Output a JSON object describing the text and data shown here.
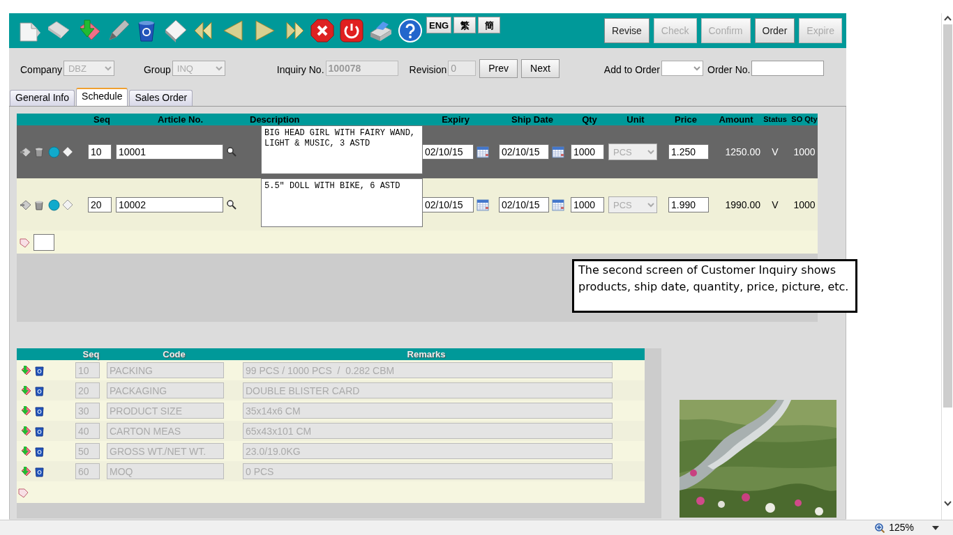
{
  "toolbar": {
    "language_buttons": [
      {
        "label": "ENG"
      },
      {
        "label": "繁"
      },
      {
        "label": "簡"
      }
    ],
    "action_buttons": [
      {
        "label": "Revise",
        "disabled": false
      },
      {
        "label": "Check",
        "disabled": true
      },
      {
        "label": "Confirm",
        "disabled": true
      },
      {
        "label": "Order",
        "disabled": false
      },
      {
        "label": "Expire",
        "disabled": true
      }
    ]
  },
  "header_form": {
    "company": {
      "label": "Company",
      "value": "DBZ",
      "disabled": true
    },
    "group": {
      "label": "Group",
      "value": "INQ",
      "disabled": true
    },
    "inquiry_no": {
      "label": "Inquiry No.",
      "value": "100078",
      "disabled": true
    },
    "revision": {
      "label": "Revision",
      "value": "0",
      "disabled": true
    },
    "nav_buttons": [
      "Prev",
      "Next"
    ],
    "add_to_order": {
      "label": "Add to Order"
    },
    "order_no": {
      "label": "Order No."
    }
  },
  "tabs": [
    {
      "label": "General Info",
      "selected": false
    },
    {
      "label": "Schedule",
      "selected": true
    },
    {
      "label": "Sales Order",
      "selected": false
    }
  ],
  "items": {
    "columns": [
      "Seq",
      "Article No.",
      "Description",
      "Expiry",
      "Ship Date",
      "Qty",
      "Unit",
      "Price",
      "Amount",
      "Status",
      "SO Qty"
    ],
    "rows": [
      {
        "seq": "10",
        "article_no": "10001",
        "description": "BIG HEAD GIRL WITH FAIRY WAND, LIGHT & MUSIC, 3 ASTD",
        "expiry": "02/10/15",
        "ship_date": "02/10/15",
        "qty": "1000",
        "unit": "PCS",
        "price": "1.250",
        "amount": "1250.00",
        "status": "V",
        "so_qty": "1000",
        "selected": true
      },
      {
        "seq": "20",
        "article_no": "10002",
        "description": "5.5\" DOLL WITH BIKE, 6 ASTD",
        "expiry": "02/10/15",
        "ship_date": "02/10/15",
        "qty": "1000",
        "unit": "PCS",
        "price": "1.990",
        "amount": "1990.00",
        "status": "V",
        "so_qty": "1000",
        "selected": false
      }
    ]
  },
  "remarks": {
    "columns": [
      "Seq",
      "Code",
      "Remarks"
    ],
    "rows": [
      {
        "seq": "10",
        "code": "PACKING",
        "remarks": "99 PCS / 1000 PCS  /  0.282 CBM"
      },
      {
        "seq": "20",
        "code": "PACKAGING",
        "remarks": "DOUBLE BLISTER CARD"
      },
      {
        "seq": "30",
        "code": "PRODUCT SIZE",
        "remarks": "35x14x6 CM"
      },
      {
        "seq": "40",
        "code": "CARTON MEAS",
        "remarks": "65x43x101 CM"
      },
      {
        "seq": "50",
        "code": "GROSS WT./NET WT.",
        "remarks": "23.0/19.0KG"
      },
      {
        "seq": "60",
        "code": "MOQ",
        "remarks": "0 PCS"
      }
    ]
  },
  "callout": {
    "text": "The second screen of Customer Inquiry shows products, ship date, quantity, price, picture, etc."
  },
  "status_bar": {
    "zoom": "125%"
  }
}
